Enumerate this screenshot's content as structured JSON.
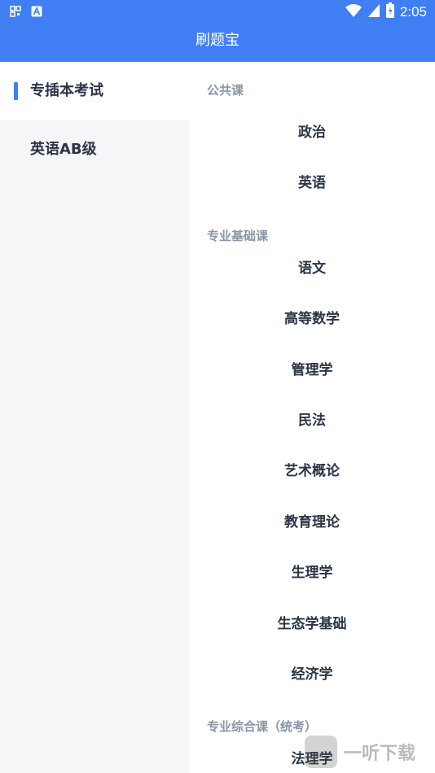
{
  "status_bar": {
    "time": "2:05",
    "icons": [
      "qr-icon",
      "a-icon",
      "wifi-icon",
      "signal-icon",
      "battery-icon"
    ]
  },
  "header": {
    "title": "刷题宝"
  },
  "sidebar": {
    "items": [
      {
        "label": "专插本考试",
        "active": true
      },
      {
        "label": "英语AB级",
        "active": false
      }
    ]
  },
  "content": {
    "sections": [
      {
        "title": "公共课",
        "courses": [
          "政治",
          "英语"
        ]
      },
      {
        "title": "专业基础课",
        "courses": [
          "语文",
          "高等数学",
          "管理学",
          "民法",
          "艺术概论",
          "教育理论",
          "生理学",
          "生态学基础",
          "经济学"
        ]
      },
      {
        "title": "专业综合课（统考）",
        "courses": [
          "法理学"
        ]
      }
    ]
  },
  "watermark": {
    "text": "一听下载"
  },
  "colors": {
    "accent": "#3f7ff3",
    "sidebar_bg": "#f5f6f8",
    "text": "#2b3546",
    "muted": "#8a94a6"
  }
}
